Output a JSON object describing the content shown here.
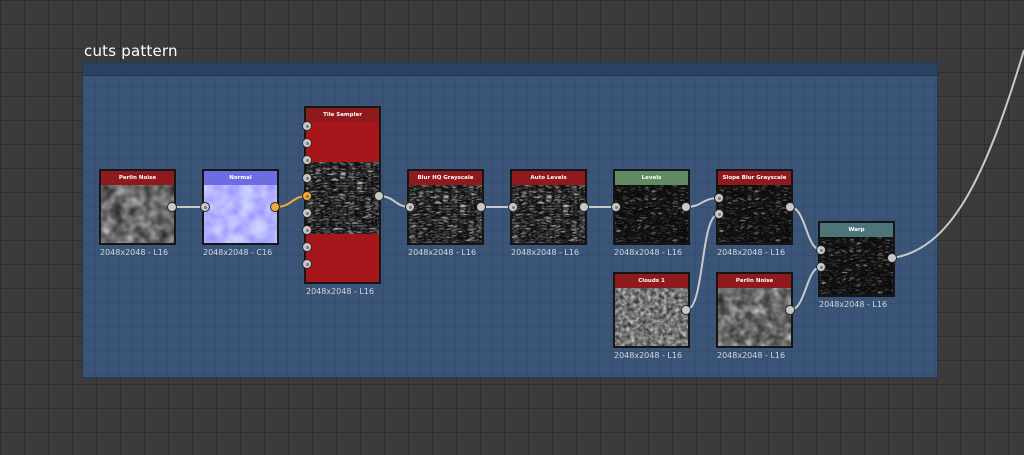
{
  "frame": {
    "title": "cuts pattern"
  },
  "colors": {
    "header_red": "#8f1a1d",
    "header_blue": "#6b6de0",
    "header_green": "#5f8a62",
    "header_teal": "#4d7479",
    "active_link": "#f2a93b",
    "frame_fill": "#3a5578"
  },
  "nodes": {
    "perlin_noise_1": {
      "title": "Perlin Noise",
      "caption": "2048x2048 - L16"
    },
    "normal": {
      "title": "Normal",
      "caption": "2048x2048 - C16"
    },
    "tile_sampler": {
      "title": "Tile Sampler",
      "caption": "2048x2048 - L16"
    },
    "blur_hq": {
      "title": "Blur HQ Grayscale",
      "caption": "2048x2048 - L16"
    },
    "auto_levels": {
      "title": "Auto Levels",
      "caption": "2048x2048 - L16"
    },
    "levels": {
      "title": "Levels",
      "caption": "2048x2048 - L16"
    },
    "slope_blur": {
      "title": "Slope Blur Grayscale",
      "caption": "2048x2048 - L16"
    },
    "clouds_1": {
      "title": "Clouds 1",
      "caption": "2048x2048 - L16"
    },
    "perlin_noise_2": {
      "title": "Perlin Noise",
      "caption": "2048x2048 - L16"
    },
    "warp": {
      "title": "Warp",
      "caption": "2048x2048 - L16"
    }
  }
}
